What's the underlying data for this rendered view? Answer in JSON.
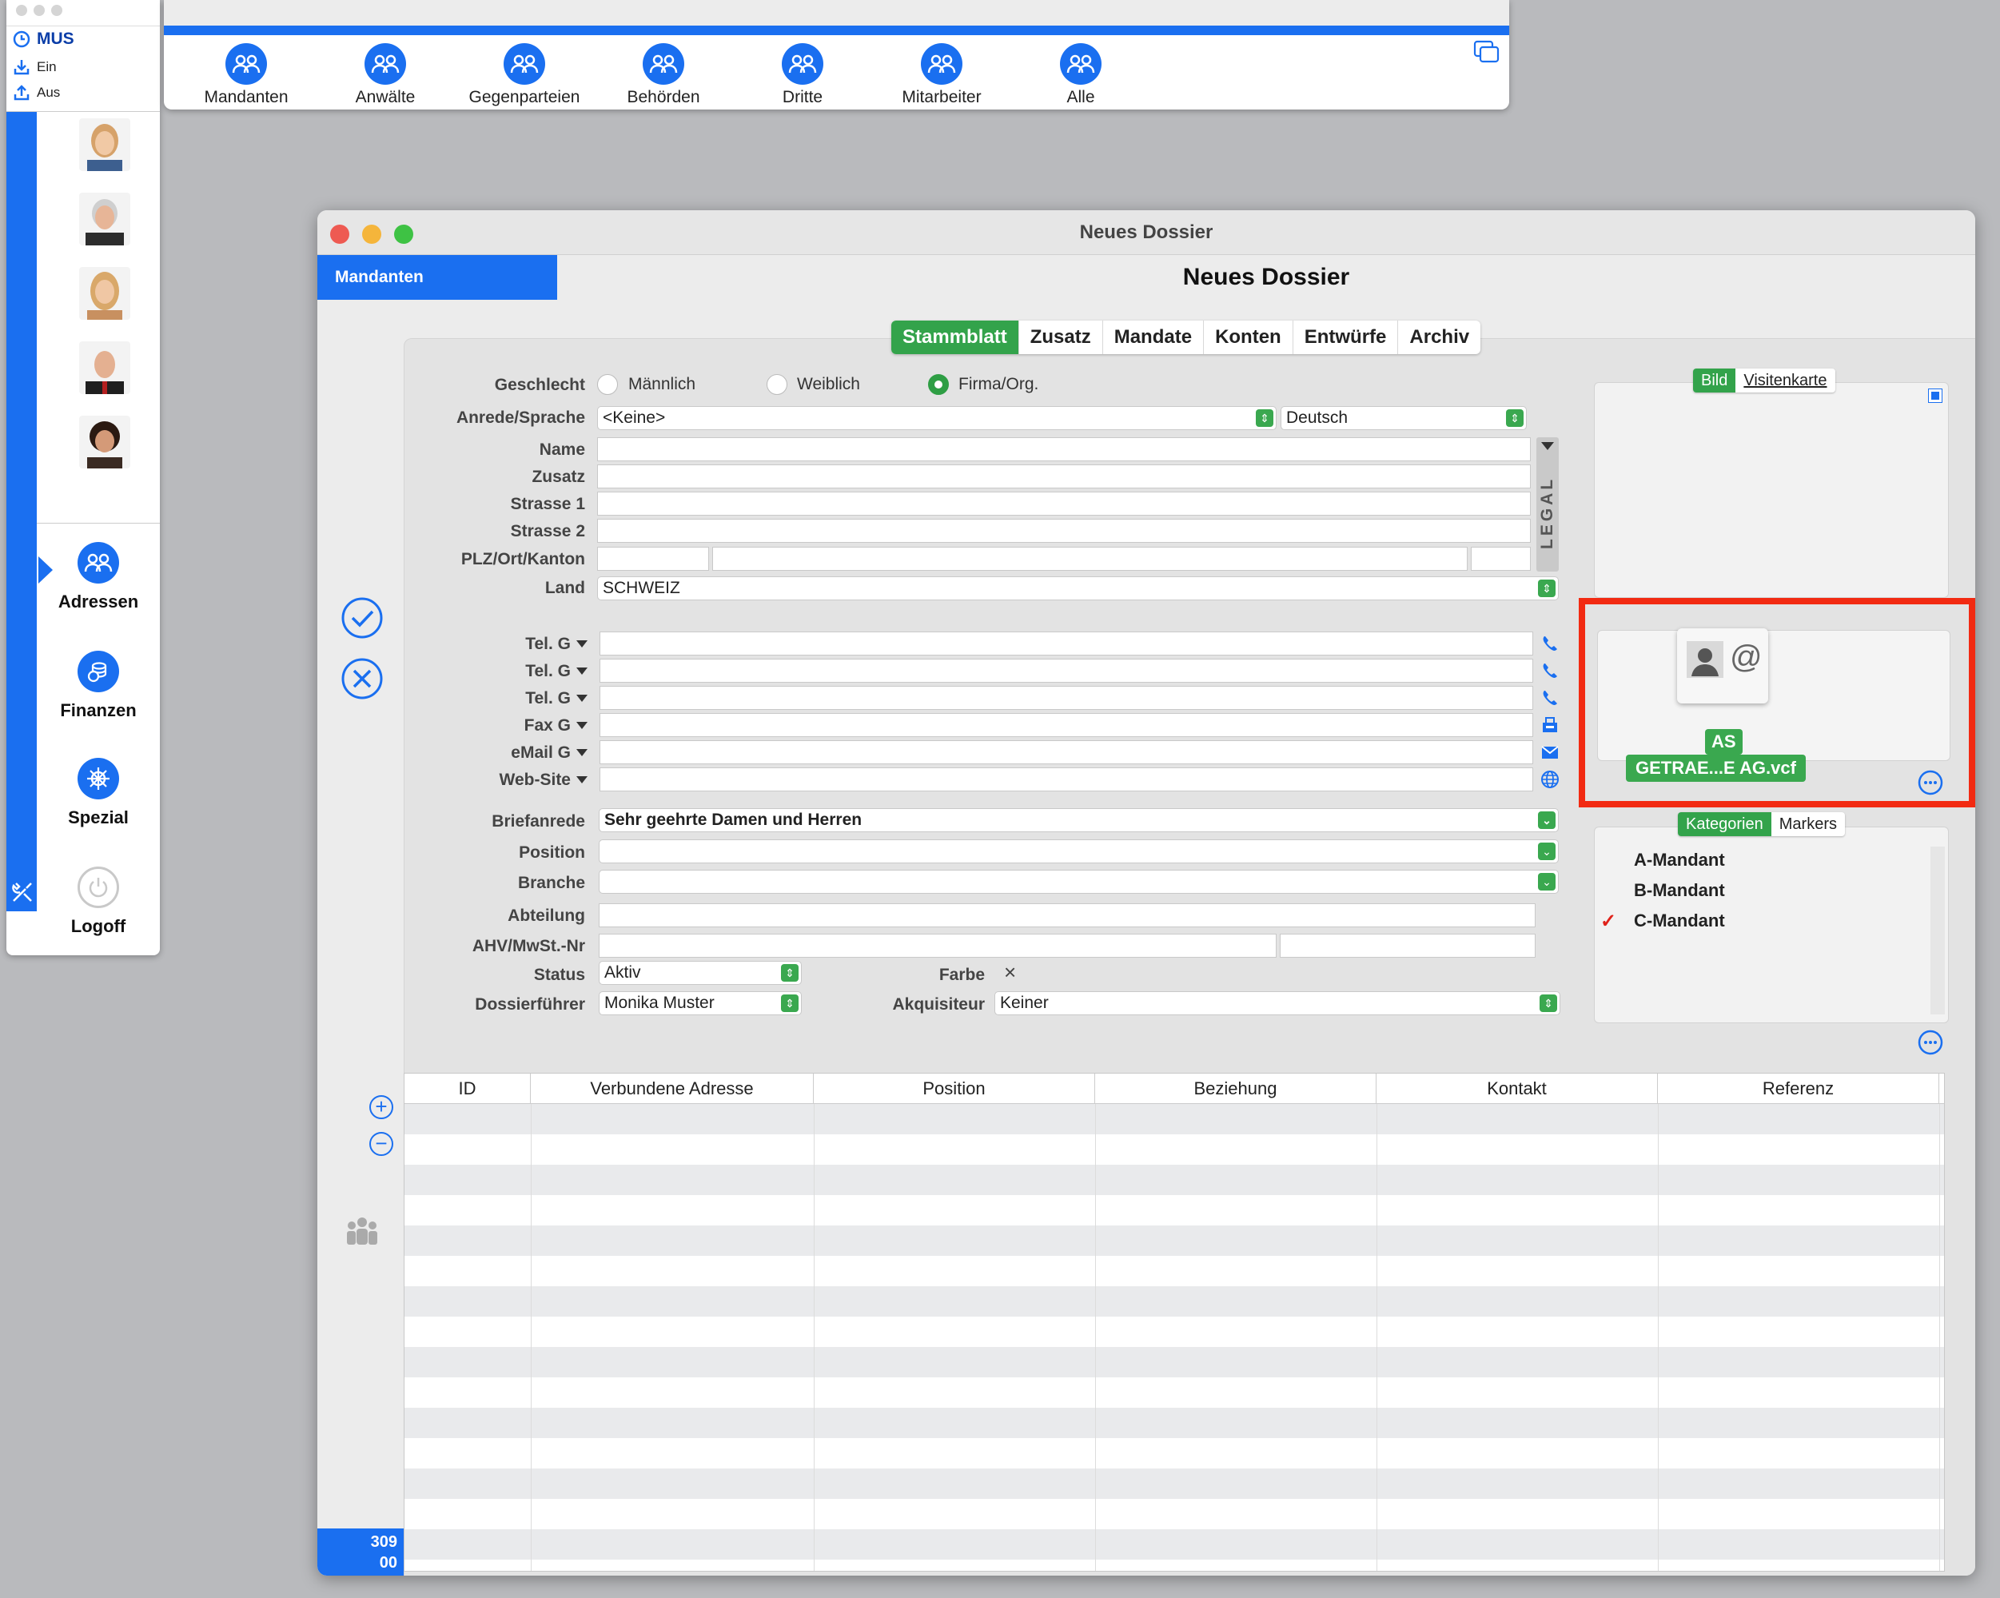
{
  "sidebar": {
    "user": "MUS",
    "clock_in": "Ein",
    "clock_out": "Aus",
    "nav": [
      {
        "label": "Adressen",
        "icon": "people-icon"
      },
      {
        "label": "Finanzen",
        "icon": "coins-icon"
      },
      {
        "label": "Spezial",
        "icon": "helm-icon"
      },
      {
        "label": "Logoff",
        "icon": "power-icon"
      }
    ]
  },
  "toolbar": {
    "buttons": [
      "Mandanten",
      "Anwälte",
      "Gegenparteien",
      "Behörden",
      "Dritte",
      "Mitarbeiter",
      "Alle"
    ]
  },
  "window": {
    "title": "Neues Dossier",
    "heading": "Neues Dossier",
    "side_tab": "Mandanten",
    "tabs": [
      "Stammblatt",
      "Zusatz",
      "Mandate",
      "Konten",
      "Entwürfe",
      "Archiv"
    ],
    "active_tab": "Stammblatt",
    "counter_line1": "309",
    "counter_line2": "00"
  },
  "form": {
    "geschlecht_label": "Geschlecht",
    "gender_options": [
      "Männlich",
      "Weiblich",
      "Firma/Org."
    ],
    "gender_selected": "Firma/Org.",
    "anrede_label": "Anrede/Sprache",
    "anrede_value": "<Keine>",
    "sprache_value": "Deutsch",
    "name_label": "Name",
    "zusatz_label": "Zusatz",
    "strasse1_label": "Strasse 1",
    "strasse2_label": "Strasse 2",
    "plz_label": "PLZ/Ort/Kanton",
    "land_label": "Land",
    "land_value": "SCHWEIZ",
    "legal_text": "LEGAL",
    "contacts": [
      {
        "label": "Tel. G",
        "icon": "phone-icon"
      },
      {
        "label": "Tel. G",
        "icon": "phone-icon"
      },
      {
        "label": "Tel. G",
        "icon": "phone-icon"
      },
      {
        "label": "Fax G",
        "icon": "fax-icon"
      },
      {
        "label": "eMail G",
        "icon": "mail-icon"
      },
      {
        "label": "Web-Site",
        "icon": "globe-icon"
      }
    ],
    "briefanrede_label": "Briefanrede",
    "briefanrede_value": "Sehr geehrte Damen und Herren",
    "position_label": "Position",
    "branche_label": "Branche",
    "abteilung_label": "Abteilung",
    "ahv_label": "AHV/MwSt.-Nr",
    "status_label": "Status",
    "status_value": "Aktiv",
    "farbe_label": "Farbe",
    "farbe_value": "×",
    "dossierfuehrer_label": "Dossierführer",
    "dossierfuehrer_value": "Monika Muster",
    "akquisiteur_label": "Akquisiteur",
    "akquisiteur_value": "Keiner"
  },
  "image_panel": {
    "tabs": [
      "Bild",
      "Visitenkarte"
    ],
    "active_tab": "Bild",
    "vcf_initials": "AS",
    "vcf_filename": "GETRAE...E AG.vcf"
  },
  "categories": {
    "tabs": [
      "Kategorien",
      "Markers"
    ],
    "active_tab": "Kategorien",
    "items": [
      {
        "label": "A-Mandant",
        "checked": false
      },
      {
        "label": "B-Mandant",
        "checked": false
      },
      {
        "label": "C-Mandant",
        "checked": true
      }
    ],
    "check_mark": "✓"
  },
  "table": {
    "columns": [
      "ID",
      "Verbundene Adresse",
      "Position",
      "Beziehung",
      "Kontakt",
      "Referenz"
    ]
  },
  "colors": {
    "accent": "#1a6ff0",
    "active_green": "#33a34b",
    "highlight_red": "#f22a12"
  }
}
